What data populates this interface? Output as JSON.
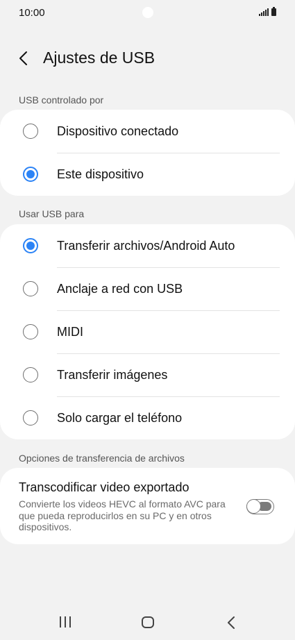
{
  "status_bar": {
    "time": "10:00"
  },
  "header": {
    "title": "Ajustes de USB"
  },
  "sections": {
    "controlled_by": {
      "label": "USB controlado por",
      "options": [
        {
          "label": "Dispositivo conectado",
          "checked": false
        },
        {
          "label": "Este dispositivo",
          "checked": true
        }
      ]
    },
    "use_for": {
      "label": "Usar USB para",
      "options": [
        {
          "label": "Transferir archivos/Android Auto",
          "checked": true
        },
        {
          "label": "Anclaje a red con USB",
          "checked": false
        },
        {
          "label": "MIDI",
          "checked": false
        },
        {
          "label": "Transferir imágenes",
          "checked": false
        },
        {
          "label": "Solo cargar el teléfono",
          "checked": false
        }
      ]
    },
    "transfer_options": {
      "label": "Opciones de transferencia de archivos",
      "toggle": {
        "title": "Transcodificar video exportado",
        "description": "Convierte los videos HEVC al formato AVC para que pueda reproducirlos en su PC y en otros dispositivos.",
        "on": false
      }
    }
  },
  "colors": {
    "accent": "#2b83f6",
    "background": "#f2f2f2",
    "card": "#ffffff"
  },
  "icons": {
    "back": "chevron-left-icon",
    "nav_recent": "recent-apps-icon",
    "nav_home": "home-icon",
    "nav_back": "back-icon"
  }
}
